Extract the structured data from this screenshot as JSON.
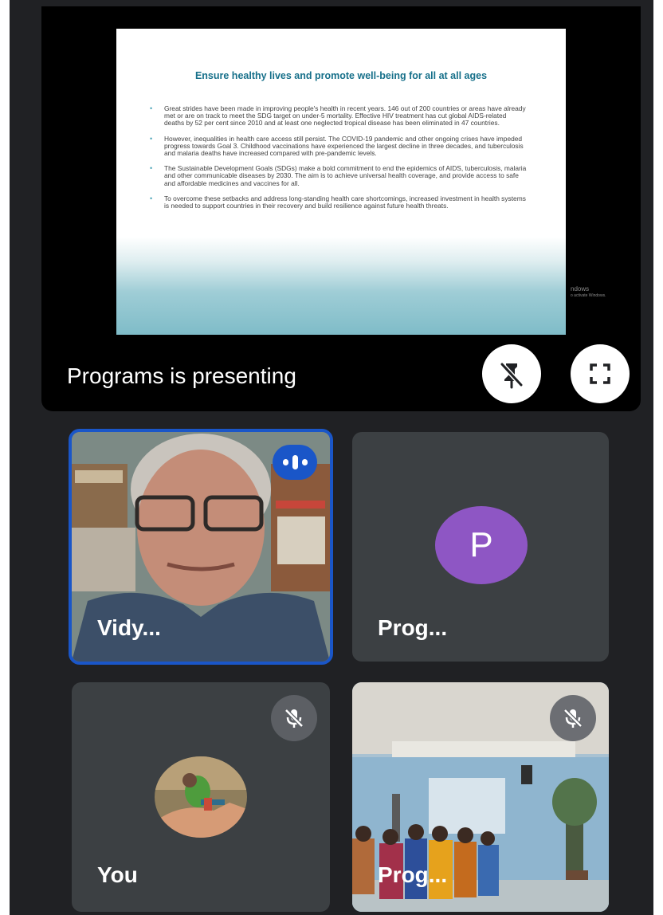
{
  "presentation": {
    "slide_title": "Ensure healthy lives and promote well-being for all at all ages",
    "bullets": [
      "Great strides have been made in improving people's health in recent years. 146 out of 200 countries or areas have already met or are on track to meet the SDG target on under-5 mortality. Effective HIV treatment has cut global AIDS-related deaths by 52 per cent since 2010 and at least one neglected tropical disease has been eliminated in 47 countries.",
      "However, inequalities in health care access still persist. The COVID-19 pandemic and other ongoing crises have impeded progress towards Goal 3. Childhood vaccinations have experienced the largest decline in three decades, and tuberculosis and malaria deaths have increased compared with pre-pandemic levels.",
      "The Sustainable Development Goals (SDGs) make a bold commitment to end the epidemics of AIDS, tuberculosis, malaria and other communicable diseases by 2030. The aim is to achieve universal health coverage, and provide access to safe and affordable medicines and vaccines for all.",
      "To overcome these setbacks and address long-standing health care shortcomings, increased investment in health systems is needed to support countries in their recovery and build resilience against future health threats."
    ],
    "watermark_line1": "ndows",
    "watermark_line2": "o activate Windows.",
    "presenting_label": "Programs is presenting",
    "pin_icon": "unpin-icon",
    "fullscreen_icon": "fullscreen-icon"
  },
  "participants": [
    {
      "name": "Vidy...",
      "state": "speaking"
    },
    {
      "name": "Prog...",
      "avatar_letter": "P",
      "avatar_color": "#8e56c4"
    },
    {
      "name": "You",
      "state": "muted"
    },
    {
      "name": "Prog...",
      "state": "muted"
    }
  ],
  "colors": {
    "background": "#202124",
    "tile": "#3c4043",
    "active_speaker": "#1a56c8",
    "slide_title": "#17708a"
  }
}
